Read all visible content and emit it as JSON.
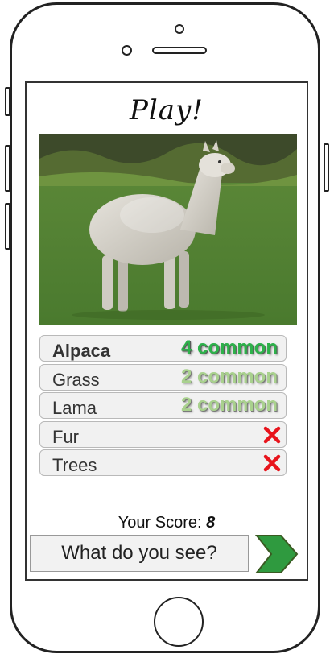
{
  "screen": {
    "title": "Play!",
    "image_description": "alpaca-standing-on-grass",
    "tags": [
      {
        "label": "Alpaca",
        "common": "4 common",
        "status": "best"
      },
      {
        "label": "Grass",
        "common": "2 common",
        "status": "match"
      },
      {
        "label": "Lama",
        "common": "2 common",
        "status": "match"
      },
      {
        "label": "Fur",
        "common": "",
        "status": "miss"
      },
      {
        "label": "Trees",
        "common": "",
        "status": "miss"
      }
    ],
    "score_label": "Your Score:",
    "score_value": "8",
    "guess_placeholder": "What do you see?",
    "submit_icon": "chevron-right-icon"
  },
  "colors": {
    "accent_green": "#2db14a",
    "muted_green": "#a9d18e",
    "miss_red": "#e8141c",
    "submit_fill": "#2f9a3f"
  }
}
